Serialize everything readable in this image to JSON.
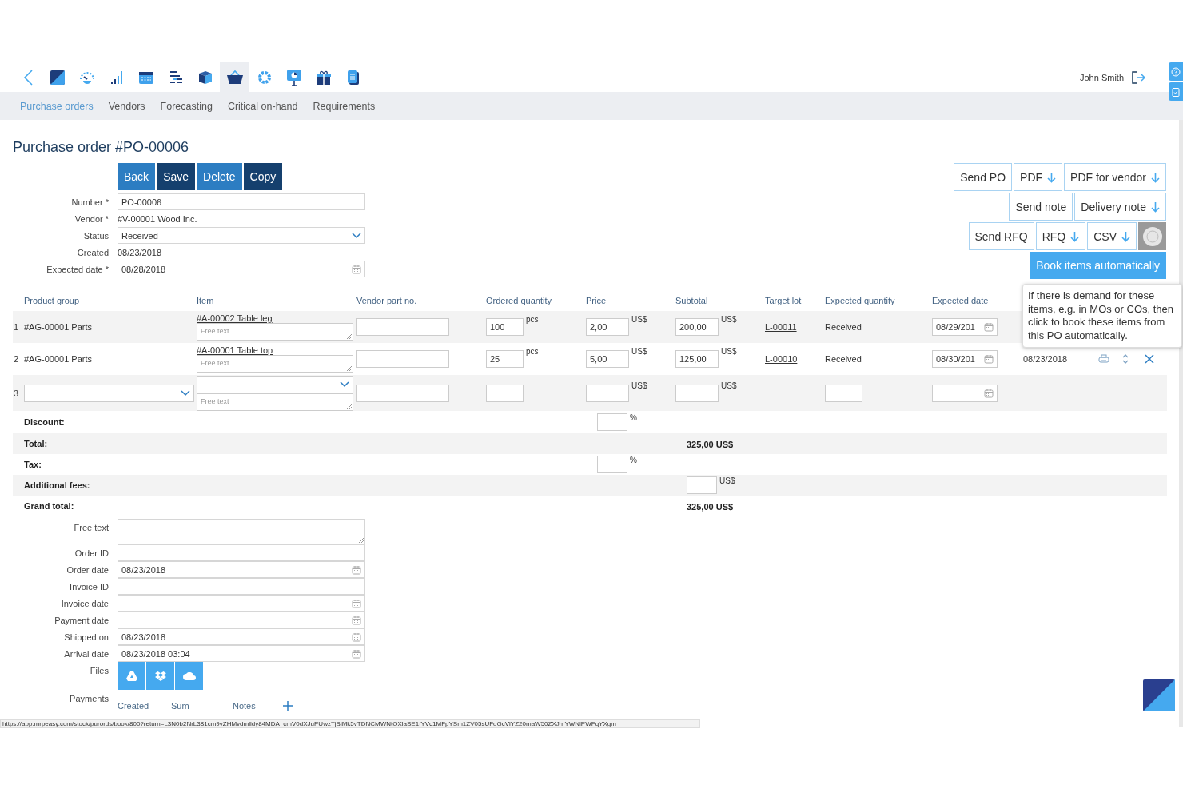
{
  "modules": [
    {
      "selected": false
    },
    {
      "selected": false
    },
    {
      "selected": false
    },
    {
      "selected": false
    },
    {
      "selected": false
    },
    {
      "selected": false
    },
    {
      "selected": true
    },
    {
      "selected": false
    },
    {
      "selected": false
    },
    {
      "selected": false
    },
    {
      "selected": false
    }
  ],
  "user": {
    "name": "John Smith"
  },
  "subnav": [
    {
      "label": "Purchase orders",
      "selected": true
    },
    {
      "label": "Vendors",
      "selected": false
    },
    {
      "label": "Forecasting",
      "selected": false
    },
    {
      "label": "Critical on-hand",
      "selected": false
    },
    {
      "label": "Requirements",
      "selected": false
    }
  ],
  "title": "Purchase order #PO-00006",
  "actions": [
    {
      "label": "Back",
      "kind": "light"
    },
    {
      "label": "Save",
      "kind": "dark"
    },
    {
      "label": "Delete",
      "kind": "light"
    },
    {
      "label": "Copy",
      "kind": "dark"
    }
  ],
  "header_fields": [
    {
      "label": "Number *",
      "kind": "text",
      "value": "PO-00006"
    },
    {
      "label": "Vendor *",
      "kind": "static",
      "value": "#V-00001 Wood Inc."
    },
    {
      "label": "Status",
      "kind": "select",
      "value": "Received"
    },
    {
      "label": "Created",
      "kind": "static",
      "value": "08/23/2018"
    },
    {
      "label": "Expected date *",
      "kind": "date",
      "value": "08/28/2018"
    }
  ],
  "export_rows": [
    [
      {
        "label": "Send PO",
        "download": false
      },
      {
        "label": "PDF",
        "download": true
      },
      {
        "label": "PDF for vendor",
        "download": true
      }
    ],
    [
      {
        "label": "Send note",
        "download": false
      },
      {
        "label": "Delivery note",
        "download": true
      }
    ],
    [
      {
        "label": "Send RFQ",
        "download": false
      },
      {
        "label": "RFQ",
        "download": true
      },
      {
        "label": "CSV",
        "download": true
      }
    ]
  ],
  "book_button": {
    "label": "Book items automatically"
  },
  "tooltip": "If there is demand for these items, e.g. in MOs or COs, then click to book these items from this PO automatically.",
  "columns": [
    "Product group",
    "Item",
    "Vendor part no.",
    "Ordered quantity",
    "Price",
    "Subtotal",
    "Target lot",
    "Expected quantity",
    "Expected date"
  ],
  "rows": [
    {
      "kind": "line",
      "index": "1",
      "product_group": "#AG-00001 Parts",
      "item": "#A-00002 Table leg",
      "free_text": "Free text",
      "quantity": "100",
      "unit": "pcs",
      "price": "2,00",
      "price_currency": "US$",
      "subtotal": "200,00",
      "subtotal_currency": "US$",
      "target_lot": "L-00011",
      "expected_quantity": "Received",
      "expected_date": "08/29/201"
    },
    {
      "kind": "line",
      "index": "2",
      "product_group": "#AG-00001 Parts",
      "item": "#A-00001 Table top",
      "free_text": "Free text",
      "quantity": "25",
      "unit": "pcs",
      "price": "5,00",
      "price_currency": "US$",
      "subtotal": "125,00",
      "subtotal_currency": "US$",
      "target_lot": "L-00010",
      "expected_quantity": "Received",
      "expected_date": "08/30/201",
      "received_date": "08/23/2018"
    },
    {
      "kind": "new",
      "index": "3",
      "free_text": "Free text",
      "price_currency": "US$",
      "subtotal_currency": "US$"
    }
  ],
  "summary": [
    {
      "label": "Discount:",
      "kind": "price_input",
      "unit": "%"
    },
    {
      "label": "Total:",
      "kind": "total",
      "value": "325,00 US$"
    },
    {
      "label": "Tax:",
      "kind": "price_input",
      "unit": "%"
    },
    {
      "label": "Additional fees:",
      "kind": "subtotal_input",
      "unit": "US$"
    },
    {
      "label": "Grand total:",
      "kind": "total",
      "value": "325,00 US$"
    }
  ],
  "lower_fields": [
    {
      "label": "Free text",
      "kind": "textarea"
    },
    {
      "label": "Order ID",
      "kind": "text"
    },
    {
      "label": "Order date",
      "kind": "date",
      "value": "08/23/2018"
    },
    {
      "label": "Invoice ID",
      "kind": "text"
    },
    {
      "label": "Invoice date",
      "kind": "date"
    },
    {
      "label": "Payment date",
      "kind": "date"
    },
    {
      "label": "Shipped on",
      "kind": "date",
      "value": "08/23/2018"
    },
    {
      "label": "Arrival date",
      "kind": "date",
      "value": "08/23/2018 03:04"
    }
  ],
  "files_label": "Files",
  "payments": {
    "label": "Payments",
    "columns": [
      "Created",
      "Sum",
      "Notes"
    ]
  },
  "status_url": "https://app.mrpeasy.com/stock/purords/book/800?return=L3N0b2NrL381cm9vZHMvdmlldy84MDA_cmV0dXJuPUwzTjBiMk5vTDNCMWNtOXlaSE1fYVc1MFpYSm1ZV05sUFdGcVlYZ20maW50ZXJmYWNlPWFqYXgm"
}
